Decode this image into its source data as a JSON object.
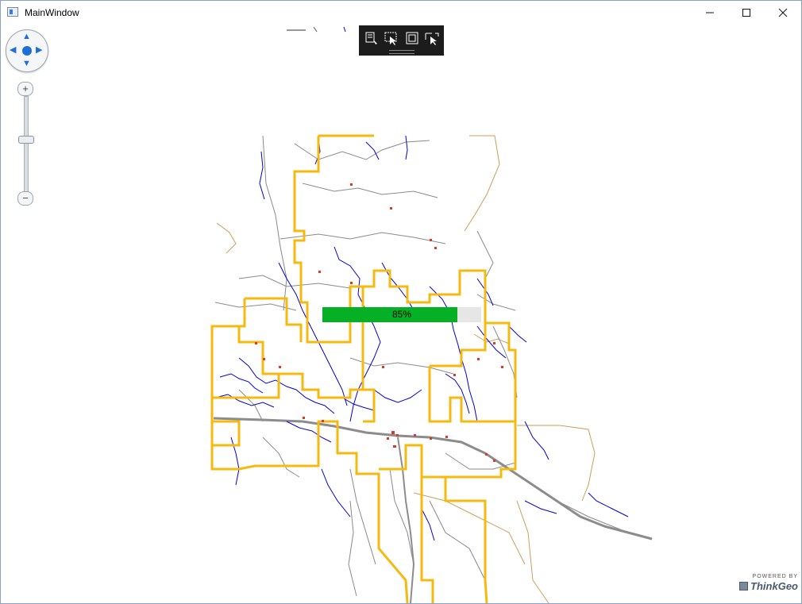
{
  "window": {
    "title": "MainWindow",
    "controls": [
      "minimize",
      "maximize",
      "close"
    ]
  },
  "map": {
    "colors": {
      "background": "#ffffff",
      "boundary": "#f6b90f",
      "water": "#0000dd",
      "roads": "#8a8a8a",
      "highway": "#8c8c8c",
      "minor": "#c9a05a",
      "points": "#d63a2a"
    }
  },
  "navigation": {
    "pan_icons": [
      "pan-up-icon",
      "pan-down-icon",
      "pan-left-icon",
      "pan-right-icon"
    ],
    "zoom_in_label": "+",
    "zoom_out_label": "−",
    "zoom_level": 0.52
  },
  "toolbar": {
    "tools": [
      "edit-tool-icon",
      "select-tool-icon",
      "rectangle-tool-icon",
      "track-select-icon"
    ]
  },
  "progress": {
    "value": 85,
    "label": "85%"
  },
  "branding": {
    "powered_by": "POWERED BY",
    "name": "ThinkGeo"
  }
}
